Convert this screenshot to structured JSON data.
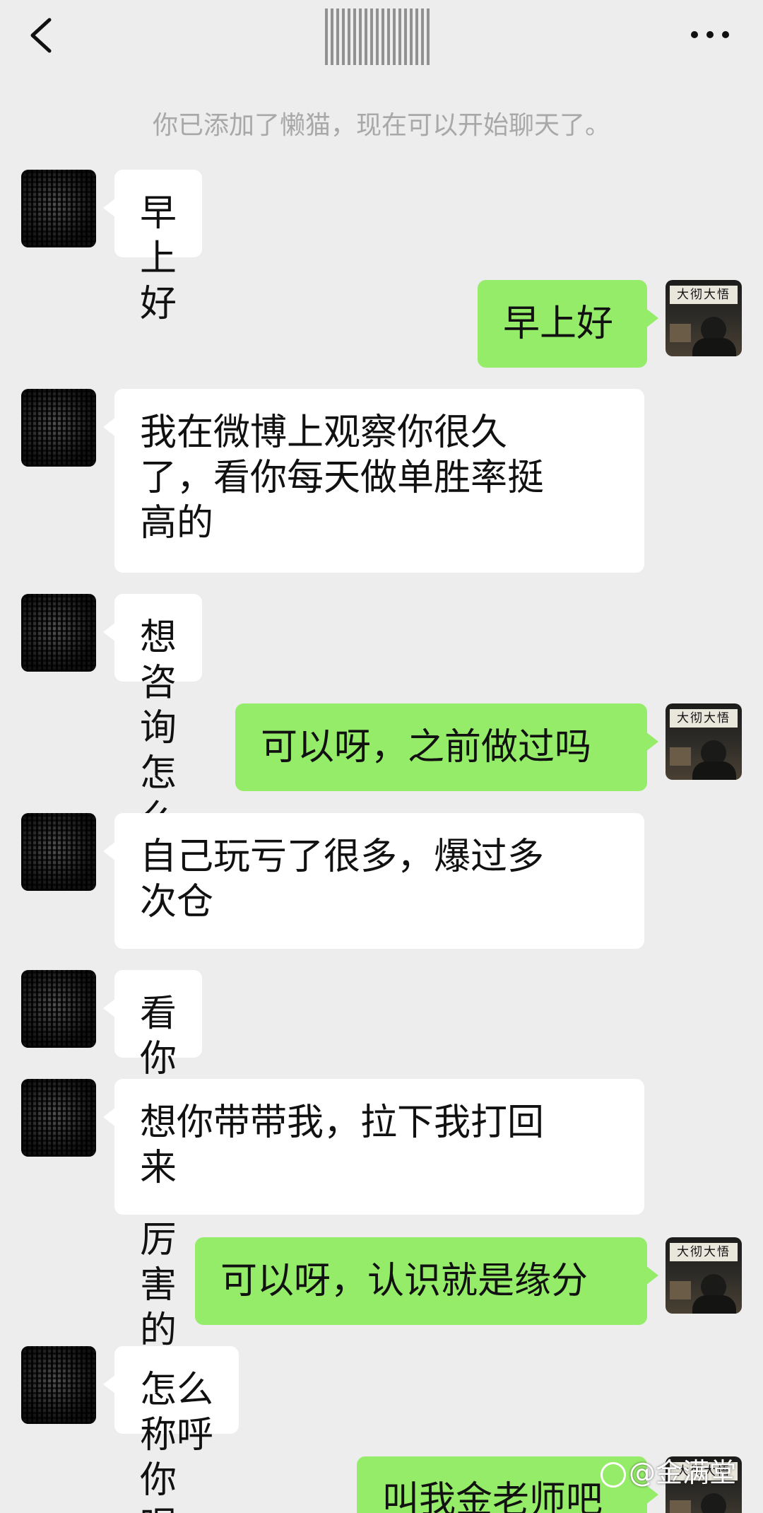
{
  "header": {
    "title": "",
    "back_icon": "chevron-left-icon",
    "more_icon": "more-dots-icon"
  },
  "system_notice": "你已添加了懒猫，现在可以开始聊天了。",
  "messages": [
    {
      "side": "left",
      "text": "早上好"
    },
    {
      "side": "right",
      "text": "早上好"
    },
    {
      "side": "left",
      "text": "我在微博上观察你很久\n了，看你每天做单胜率挺\n高的"
    },
    {
      "side": "left",
      "text": "想咨询怎么跟"
    },
    {
      "side": "right",
      "text": "可以呀，之前做过吗"
    },
    {
      "side": "left",
      "text": "自己玩亏了很多，爆过多\n次仓"
    },
    {
      "side": "left",
      "text": "看你挺稳挺厉害的"
    },
    {
      "side": "left",
      "text": "想你带带我，拉下我打回\n来"
    },
    {
      "side": "right",
      "text": "可以呀，认识就是缘分"
    },
    {
      "side": "left",
      "text": "怎么称呼你呢，老师"
    },
    {
      "side": "right",
      "text": "叫我金老师吧"
    }
  ],
  "my_avatar_sign": "大彻大悟",
  "watermark": "@金满堂",
  "colors": {
    "background": "#ededed",
    "left_bubble": "#ffffff",
    "right_bubble": "#95ec69",
    "notice_text": "#a8a8a8"
  }
}
